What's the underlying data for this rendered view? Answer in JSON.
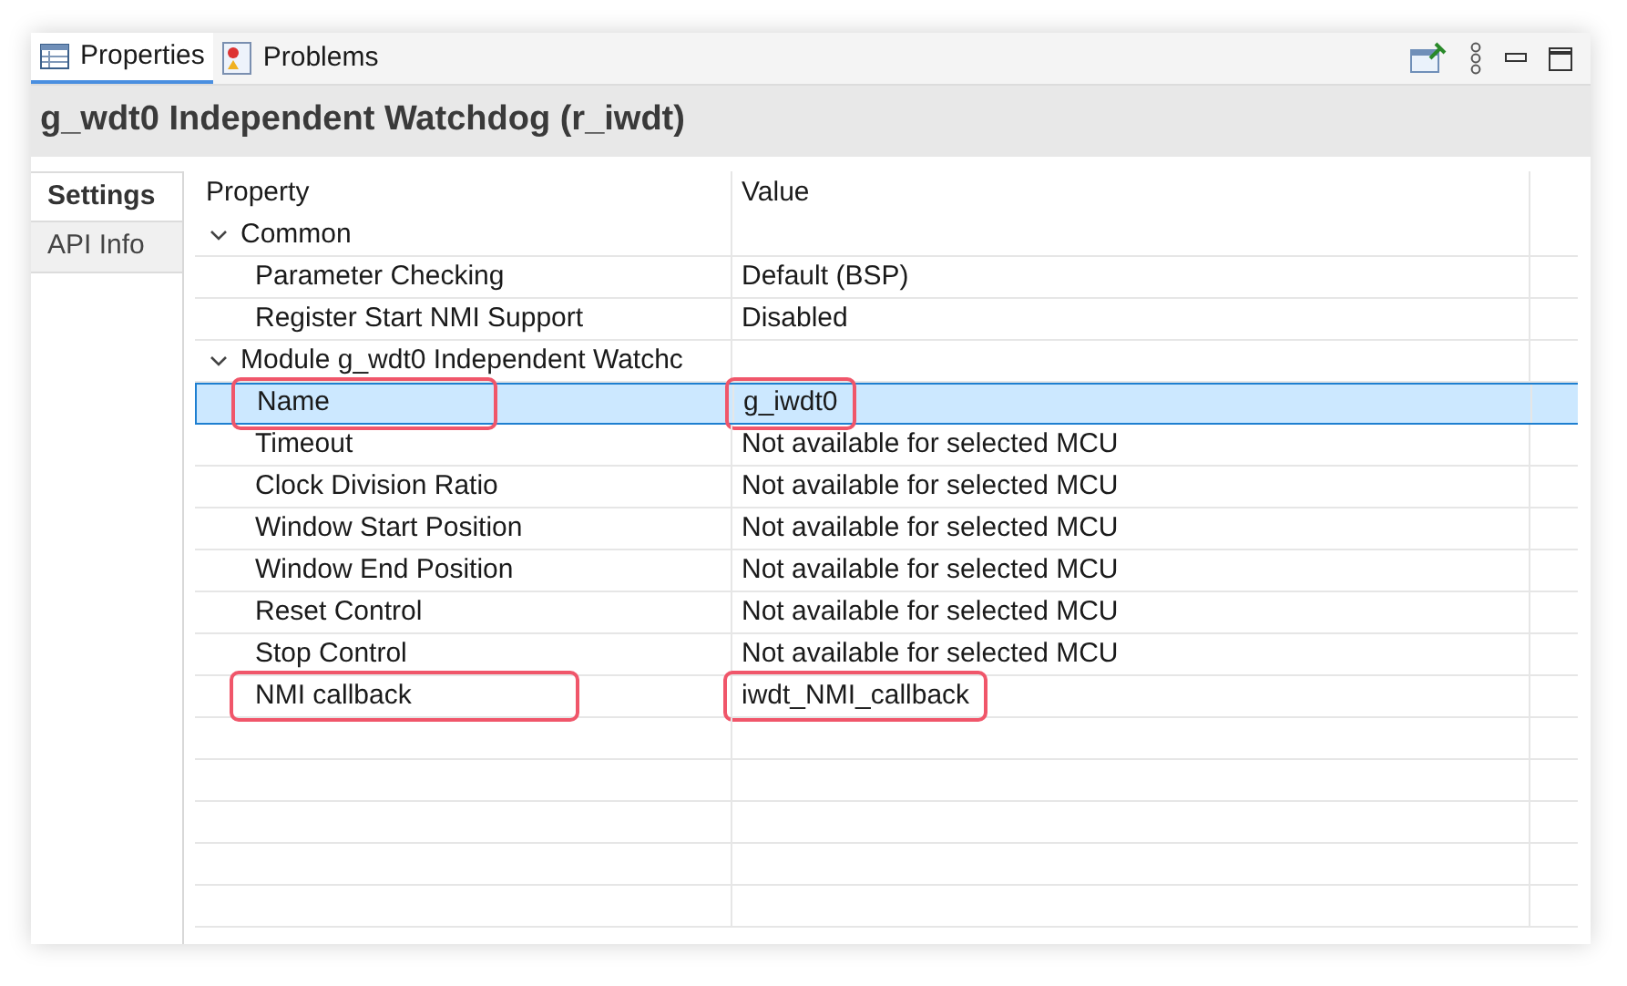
{
  "view_tabs": [
    {
      "label": "Properties",
      "selected": true,
      "kind": "table"
    },
    {
      "label": "Problems",
      "selected": false,
      "kind": "problems"
    }
  ],
  "title": "g_wdt0 Independent Watchdog (r_iwdt)",
  "side_tabs": [
    {
      "label": "Settings",
      "selected": true
    },
    {
      "label": "API Info",
      "selected": false
    }
  ],
  "table": {
    "columns": [
      "Property",
      "Value"
    ],
    "groups": [
      {
        "label": "Common",
        "expanded": true,
        "children": [
          {
            "property": "Parameter Checking",
            "value": "Default (BSP)",
            "selected": false,
            "highlighted": false
          },
          {
            "property": "Register Start NMI Support",
            "value": "Disabled",
            "selected": false,
            "highlighted": false
          }
        ]
      },
      {
        "label": "Module g_wdt0 Independent Watchc",
        "expanded": true,
        "children": [
          {
            "property": "Name",
            "value": "g_iwdt0",
            "selected": true,
            "highlighted": true
          },
          {
            "property": "Timeout",
            "value": "Not available for selected MCU",
            "selected": false,
            "highlighted": false
          },
          {
            "property": "Clock Division Ratio",
            "value": "Not available for selected MCU",
            "selected": false,
            "highlighted": false
          },
          {
            "property": "Window Start Position",
            "value": "Not available for selected MCU",
            "selected": false,
            "highlighted": false
          },
          {
            "property": "Window End Position",
            "value": "Not available for selected MCU",
            "selected": false,
            "highlighted": false
          },
          {
            "property": "Reset Control",
            "value": "Not available for selected MCU",
            "selected": false,
            "highlighted": false
          },
          {
            "property": "Stop Control",
            "value": "Not available for selected MCU",
            "selected": false,
            "highlighted": false
          },
          {
            "property": "NMI callback",
            "value": "iwdt_NMI_callback",
            "selected": false,
            "highlighted": true
          }
        ]
      }
    ]
  }
}
